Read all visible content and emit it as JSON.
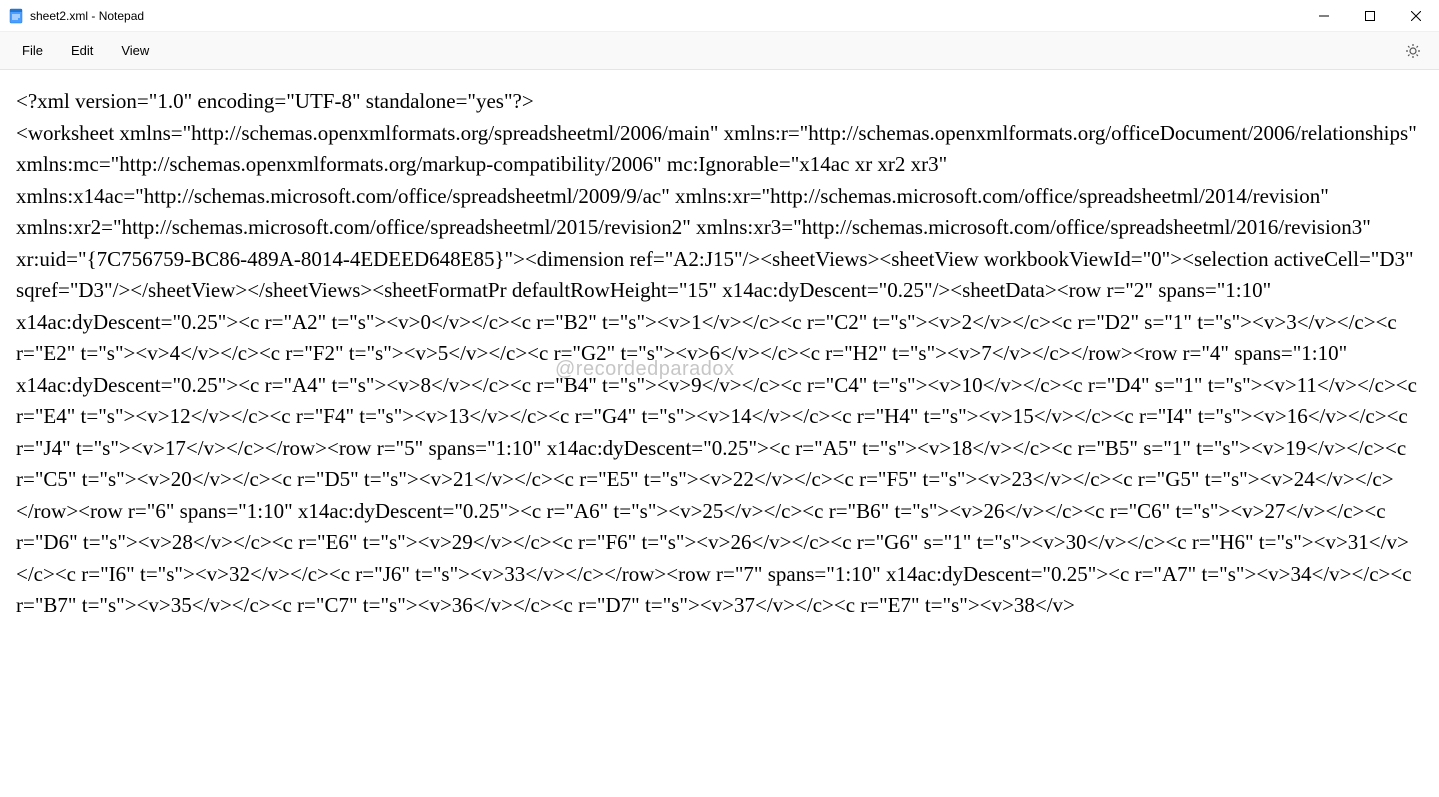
{
  "window": {
    "title": "sheet2.xml - Notepad"
  },
  "menu": {
    "file": "File",
    "edit": "Edit",
    "view": "View"
  },
  "watermark": "@recordedparadox",
  "document": {
    "text": "<?xml version=\"1.0\" encoding=\"UTF-8\" standalone=\"yes\"?>\n<worksheet xmlns=\"http://schemas.openxmlformats.org/spreadsheetml/2006/main\" xmlns:r=\"http://schemas.openxmlformats.org/officeDocument/2006/relationships\" xmlns:mc=\"http://schemas.openxmlformats.org/markup-compatibility/2006\" mc:Ignorable=\"x14ac xr xr2 xr3\" xmlns:x14ac=\"http://schemas.microsoft.com/office/spreadsheetml/2009/9/ac\" xmlns:xr=\"http://schemas.microsoft.com/office/spreadsheetml/2014/revision\" xmlns:xr2=\"http://schemas.microsoft.com/office/spreadsheetml/2015/revision2\" xmlns:xr3=\"http://schemas.microsoft.com/office/spreadsheetml/2016/revision3\" xr:uid=\"{7C756759-BC86-489A-8014-4EDEED648E85}\"><dimension ref=\"A2:J15\"/><sheetViews><sheetView workbookViewId=\"0\"><selection activeCell=\"D3\" sqref=\"D3\"/></sheetView></sheetViews><sheetFormatPr defaultRowHeight=\"15\" x14ac:dyDescent=\"0.25\"/><sheetData><row r=\"2\" spans=\"1:10\" x14ac:dyDescent=\"0.25\"><c r=\"A2\" t=\"s\"><v>0</v></c><c r=\"B2\" t=\"s\"><v>1</v></c><c r=\"C2\" t=\"s\"><v>2</v></c><c r=\"D2\" s=\"1\" t=\"s\"><v>3</v></c><c r=\"E2\" t=\"s\"><v>4</v></c><c r=\"F2\" t=\"s\"><v>5</v></c><c r=\"G2\" t=\"s\"><v>6</v></c><c r=\"H2\" t=\"s\"><v>7</v></c></row><row r=\"4\" spans=\"1:10\" x14ac:dyDescent=\"0.25\"><c r=\"A4\" t=\"s\"><v>8</v></c><c r=\"B4\" t=\"s\"><v>9</v></c><c r=\"C4\" t=\"s\"><v>10</v></c><c r=\"D4\" s=\"1\" t=\"s\"><v>11</v></c><c r=\"E4\" t=\"s\"><v>12</v></c><c r=\"F4\" t=\"s\"><v>13</v></c><c r=\"G4\" t=\"s\"><v>14</v></c><c r=\"H4\" t=\"s\"><v>15</v></c><c r=\"I4\" t=\"s\"><v>16</v></c><c r=\"J4\" t=\"s\"><v>17</v></c></row><row r=\"5\" spans=\"1:10\" x14ac:dyDescent=\"0.25\"><c r=\"A5\" t=\"s\"><v>18</v></c><c r=\"B5\" s=\"1\" t=\"s\"><v>19</v></c><c r=\"C5\" t=\"s\"><v>20</v></c><c r=\"D5\" t=\"s\"><v>21</v></c><c r=\"E5\" t=\"s\"><v>22</v></c><c r=\"F5\" t=\"s\"><v>23</v></c><c r=\"G5\" t=\"s\"><v>24</v></c></row><row r=\"6\" spans=\"1:10\" x14ac:dyDescent=\"0.25\"><c r=\"A6\" t=\"s\"><v>25</v></c><c r=\"B6\" t=\"s\"><v>26</v></c><c r=\"C6\" t=\"s\"><v>27</v></c><c r=\"D6\" t=\"s\"><v>28</v></c><c r=\"E6\" t=\"s\"><v>29</v></c><c r=\"F6\" t=\"s\"><v>26</v></c><c r=\"G6\" s=\"1\" t=\"s\"><v>30</v></c><c r=\"H6\" t=\"s\"><v>31</v></c><c r=\"I6\" t=\"s\"><v>32</v></c><c r=\"J6\" t=\"s\"><v>33</v></c></row><row r=\"7\" spans=\"1:10\" x14ac:dyDescent=\"0.25\"><c r=\"A7\" t=\"s\"><v>34</v></c><c r=\"B7\" t=\"s\"><v>35</v></c><c r=\"C7\" t=\"s\"><v>36</v></c><c r=\"D7\" t=\"s\"><v>37</v></c><c r=\"E7\" t=\"s\"><v>38</v>"
  }
}
